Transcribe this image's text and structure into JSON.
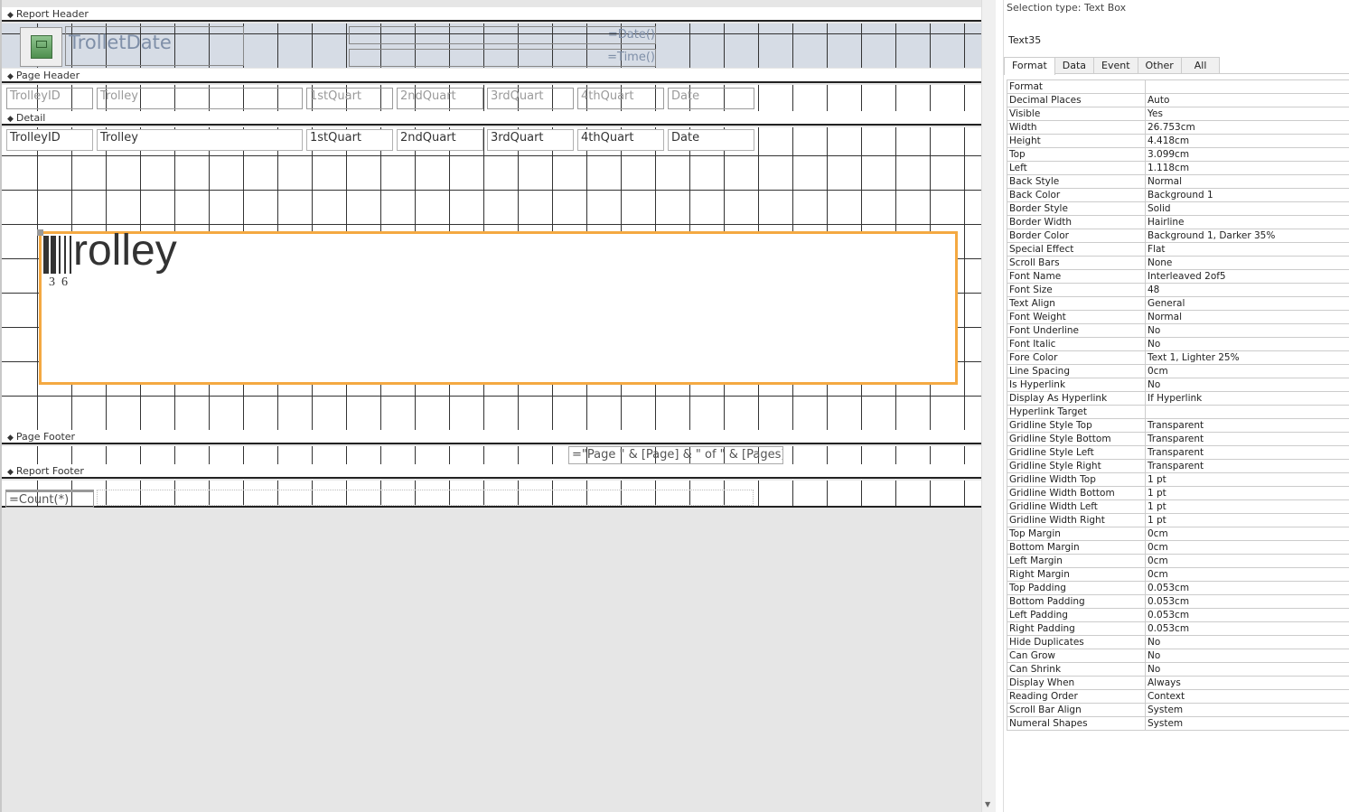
{
  "sections": {
    "report_header": "Report Header",
    "page_header": "Page Header",
    "detail": "Detail",
    "page_footer": "Page Footer",
    "report_footer": "Report Footer"
  },
  "report_header": {
    "title": "TrolletDate",
    "date_expr": "=Date()",
    "time_expr": "=Time()"
  },
  "page_header": {
    "labels": [
      "TrolleyID",
      "Trolley",
      "1stQuart",
      "2ndQuart",
      "3rdQuart",
      "4thQuart",
      "Date"
    ]
  },
  "detail": {
    "fields": [
      "TrolleyID",
      "Trolley",
      "1stQuart",
      "2ndQuart",
      "3rdQuart",
      "4thQuart",
      "Date"
    ],
    "barcode_text": "rolley",
    "barcode_digits": "3  6"
  },
  "page_footer": {
    "expr": "=\"Page \" & [Page] & \" of \" & [Pages]"
  },
  "report_footer": {
    "expr": "=Count(*)"
  },
  "props": {
    "selection_type": "Selection type:  Text Box",
    "control": "Text35",
    "tabs": [
      "Format",
      "Data",
      "Event",
      "Other",
      "All"
    ],
    "rows": [
      [
        "Format",
        ""
      ],
      [
        "Decimal Places",
        "Auto"
      ],
      [
        "Visible",
        "Yes"
      ],
      [
        "Width",
        "26.753cm"
      ],
      [
        "Height",
        "4.418cm"
      ],
      [
        "Top",
        "3.099cm"
      ],
      [
        "Left",
        "1.118cm"
      ],
      [
        "Back Style",
        "Normal"
      ],
      [
        "Back Color",
        "Background 1"
      ],
      [
        "Border Style",
        "Solid"
      ],
      [
        "Border Width",
        "Hairline"
      ],
      [
        "Border Color",
        "Background 1, Darker 35%"
      ],
      [
        "Special Effect",
        "Flat"
      ],
      [
        "Scroll Bars",
        "None"
      ],
      [
        "Font Name",
        "Interleaved 2of5"
      ],
      [
        "Font Size",
        "48"
      ],
      [
        "Text Align",
        "General"
      ],
      [
        "Font Weight",
        "Normal"
      ],
      [
        "Font Underline",
        "No"
      ],
      [
        "Font Italic",
        "No"
      ],
      [
        "Fore Color",
        "Text 1, Lighter 25%"
      ],
      [
        "Line Spacing",
        "0cm"
      ],
      [
        "Is Hyperlink",
        "No"
      ],
      [
        "Display As Hyperlink",
        "If Hyperlink"
      ],
      [
        "Hyperlink Target",
        ""
      ],
      [
        "Gridline Style Top",
        "Transparent"
      ],
      [
        "Gridline Style Bottom",
        "Transparent"
      ],
      [
        "Gridline Style Left",
        "Transparent"
      ],
      [
        "Gridline Style Right",
        "Transparent"
      ],
      [
        "Gridline Width Top",
        "1 pt"
      ],
      [
        "Gridline Width Bottom",
        "1 pt"
      ],
      [
        "Gridline Width Left",
        "1 pt"
      ],
      [
        "Gridline Width Right",
        "1 pt"
      ],
      [
        "Top Margin",
        "0cm"
      ],
      [
        "Bottom Margin",
        "0cm"
      ],
      [
        "Left Margin",
        "0cm"
      ],
      [
        "Right Margin",
        "0cm"
      ],
      [
        "Top Padding",
        "0.053cm"
      ],
      [
        "Bottom Padding",
        "0.053cm"
      ],
      [
        "Left Padding",
        "0.053cm"
      ],
      [
        "Right Padding",
        "0.053cm"
      ],
      [
        "Hide Duplicates",
        "No"
      ],
      [
        "Can Grow",
        "No"
      ],
      [
        "Can Shrink",
        "No"
      ],
      [
        "Display When",
        "Always"
      ],
      [
        "Reading Order",
        "Context"
      ],
      [
        "Scroll Bar Align",
        "System"
      ],
      [
        "Numeral Shapes",
        "System"
      ]
    ]
  }
}
